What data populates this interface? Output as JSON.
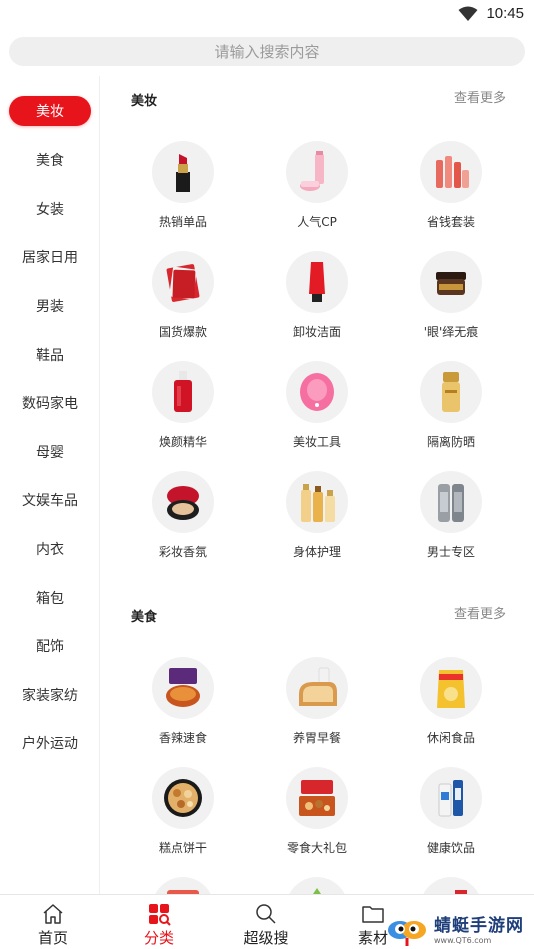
{
  "status": {
    "time": "10:45"
  },
  "search": {
    "placeholder": "请输入搜索内容"
  },
  "sidebar": {
    "items": [
      {
        "label": "美妆",
        "active": true
      },
      {
        "label": "美食"
      },
      {
        "label": "女装"
      },
      {
        "label": "居家日用"
      },
      {
        "label": "男装"
      },
      {
        "label": "鞋品"
      },
      {
        "label": "数码家电"
      },
      {
        "label": "母婴"
      },
      {
        "label": "文娱车品"
      },
      {
        "label": "内衣"
      },
      {
        "label": "箱包"
      },
      {
        "label": "配饰"
      },
      {
        "label": "家装家纺"
      },
      {
        "label": "户外运动"
      }
    ]
  },
  "sections": [
    {
      "title": "美妆",
      "more": "查看更多",
      "items": [
        {
          "label": "热销单品",
          "icon": "lipstick-icon"
        },
        {
          "label": "人气CP",
          "icon": "skincare-bottles-icon"
        },
        {
          "label": "省钱套装",
          "icon": "skincare-set-icon"
        },
        {
          "label": "国货爆款",
          "icon": "face-mask-icon"
        },
        {
          "label": "卸妆洁面",
          "icon": "cleanser-tube-icon"
        },
        {
          "label": "'眼'绎无痕",
          "icon": "eye-cream-jar-icon"
        },
        {
          "label": "焕颜精华",
          "icon": "serum-bottle-icon"
        },
        {
          "label": "美妆工具",
          "icon": "cleansing-brush-icon"
        },
        {
          "label": "隔离防晒",
          "icon": "sunscreen-icon"
        },
        {
          "label": "彩妆香氛",
          "icon": "cushion-compact-icon"
        },
        {
          "label": "身体护理",
          "icon": "body-care-bottles-icon"
        },
        {
          "label": "男士专区",
          "icon": "men-cans-icon"
        }
      ]
    },
    {
      "title": "美食",
      "more": "查看更多",
      "items": [
        {
          "label": "香辣速食",
          "icon": "spicy-noodles-icon"
        },
        {
          "label": "养胃早餐",
          "icon": "bread-icon"
        },
        {
          "label": "休闲食品",
          "icon": "snack-bag-icon"
        },
        {
          "label": "糕点饼干",
          "icon": "cookie-tin-icon"
        },
        {
          "label": "零食大礼包",
          "icon": "gift-box-icon"
        },
        {
          "label": "健康饮品",
          "icon": "milk-carton-icon"
        }
      ]
    }
  ],
  "bottom_nav": [
    {
      "label": "首页",
      "icon": "home-icon"
    },
    {
      "label": "分类",
      "icon": "category-icon",
      "active": true
    },
    {
      "label": "超级搜",
      "icon": "search-icon"
    },
    {
      "label": "素材",
      "icon": "folder-icon"
    }
  ],
  "watermark": {
    "title": "蜻蜓手游网",
    "url": "www.QT6.com"
  },
  "colors": {
    "accent": "#e8141c"
  }
}
